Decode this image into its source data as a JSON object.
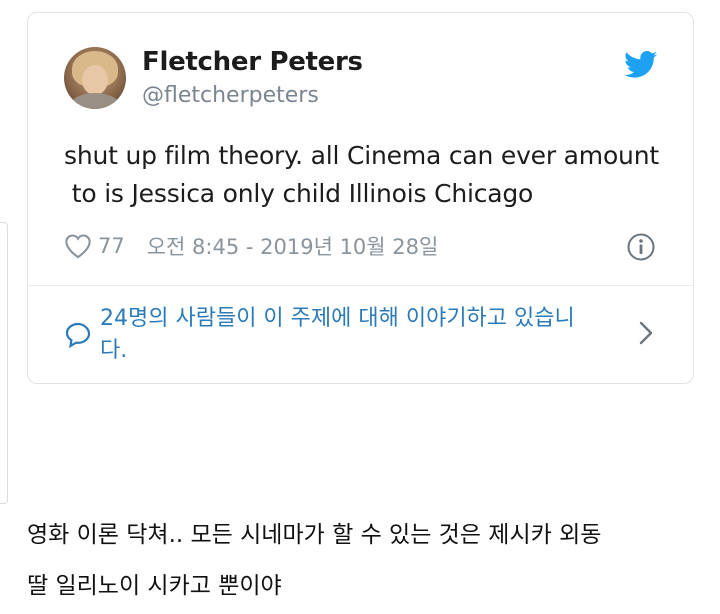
{
  "tweet": {
    "author_name": "Fletcher Peters",
    "author_handle": "@fletcherpeters",
    "text_line1": "shut up film theory. all Cinema can ever amount",
    "text_line2": " to is Jessica only child Illinois Chicago",
    "likes": "77",
    "timestamp": "오전 8:45 - 2019년 10월 28일",
    "conversation_line1": "24명의 사람들이 이 주제에 대해 이야기하고 있습니",
    "conversation_line2": "다.",
    "icons": {
      "twitter": "twitter-bird-icon",
      "like": "heart-icon",
      "info": "info-icon",
      "conversation": "speech-bubble-icon",
      "chevron": "chevron-right-icon"
    },
    "colors": {
      "twitter_blue": "#1da1f2",
      "link_blue": "#2b7bb9",
      "meta_gray": "#8a949c"
    }
  },
  "caption": {
    "line1": "영화 이론 닥쳐.. 모든 시네마가 할 수 있는 것은 제시카 외동",
    "line2": "딸 일리노이 시카고 뿐이야"
  }
}
